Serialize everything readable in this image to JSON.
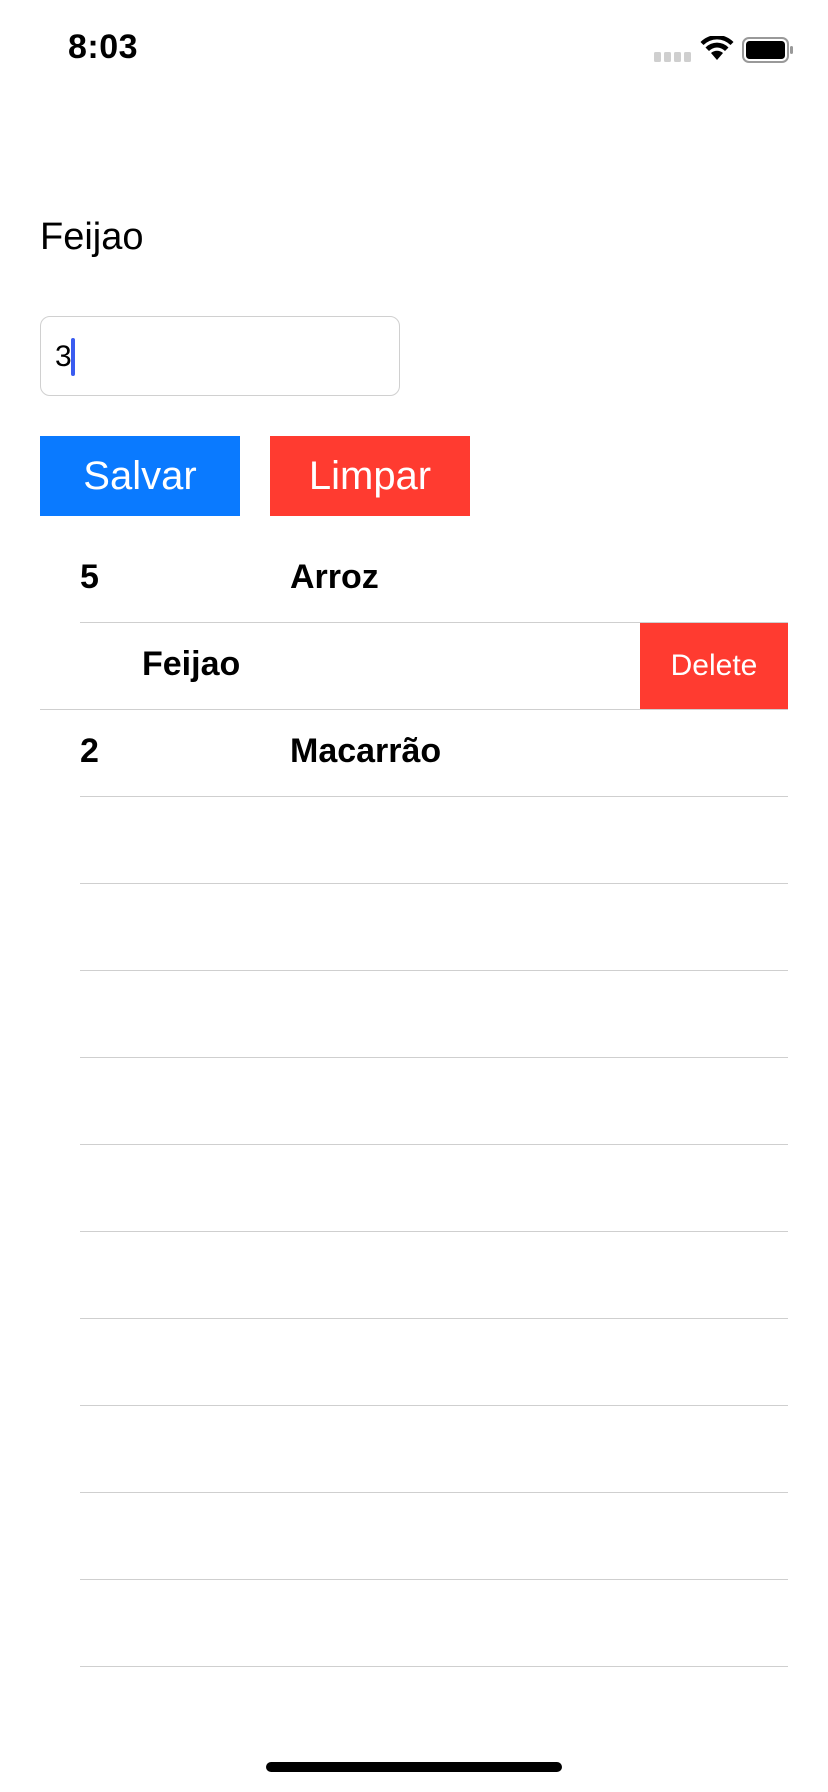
{
  "status_bar": {
    "time": "8:03",
    "icons": [
      "signal-icon",
      "wifi-icon",
      "battery-icon"
    ]
  },
  "form": {
    "item_name": "Feijao",
    "quantity_value": "3"
  },
  "buttons": {
    "save_label": "Salvar",
    "clear_label": "Limpar"
  },
  "table": {
    "rows": [
      {
        "qty": "5",
        "name": "Arroz"
      },
      {
        "qty": "",
        "name": "Feijao",
        "swiped": true,
        "delete_label": "Delete"
      },
      {
        "qty": "2",
        "name": "Macarrão"
      }
    ]
  },
  "colors": {
    "accent_blue": "#0a7aff",
    "destructive_red": "#ff3b30",
    "caret": "#3a5cf0",
    "separator": "#cfcfcf"
  }
}
